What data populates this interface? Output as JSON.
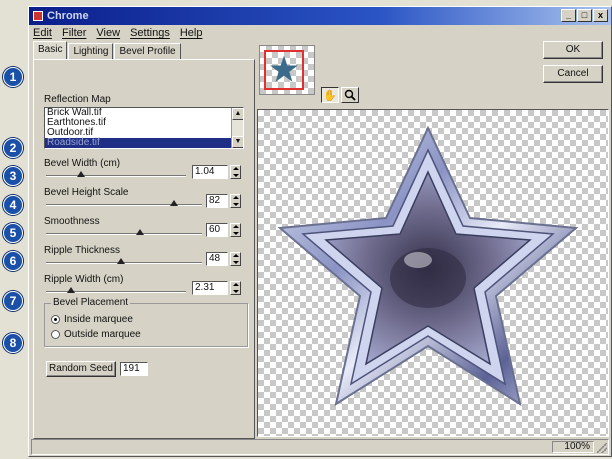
{
  "window": {
    "title": "Chrome",
    "controls": {
      "minimize": "_",
      "maximize": "□",
      "close": "x"
    }
  },
  "menu": [
    "Edit",
    "Filter",
    "View",
    "Settings",
    "Help"
  ],
  "tabs": [
    "Basic",
    "Lighting",
    "Bevel Profile"
  ],
  "reflection_map": {
    "label": "Reflection Map",
    "items": [
      "Brick Wall.tif",
      "Earthtones.tif",
      "Outdoor.tif",
      "Roadside.tif"
    ],
    "selected_index": 3
  },
  "controls": [
    {
      "label": "Bevel Width (cm)",
      "value": "1.04",
      "slider_fraction": 0.25
    },
    {
      "label": "Bevel Height Scale",
      "value": "82",
      "slider_fraction": 0.82
    },
    {
      "label": "Smoothness",
      "value": "60",
      "slider_fraction": 0.6
    },
    {
      "label": "Ripple Thickness",
      "value": "48",
      "slider_fraction": 0.48
    },
    {
      "label": "Ripple Width (cm)",
      "value": "2.31",
      "slider_fraction": 0.18
    }
  ],
  "bevel_placement": {
    "label": "Bevel Placement",
    "options": [
      "Inside marquee",
      "Outside marquee"
    ],
    "selected_index": 0
  },
  "random_seed": {
    "label": "Random Seed",
    "value": "191"
  },
  "buttons": {
    "ok": "OK",
    "cancel": "Cancel"
  },
  "status": {
    "zoom": "100%"
  },
  "badges": [
    "1",
    "2",
    "3",
    "4",
    "5",
    "6",
    "7",
    "8"
  ],
  "icons": {
    "hand": "hand-icon",
    "zoom": "magnifier-icon"
  },
  "colors": {
    "title_bar": "#0a1e8a",
    "badge": "#1a50a8",
    "selection": "#1f2f86",
    "star": "#8c96c8"
  }
}
